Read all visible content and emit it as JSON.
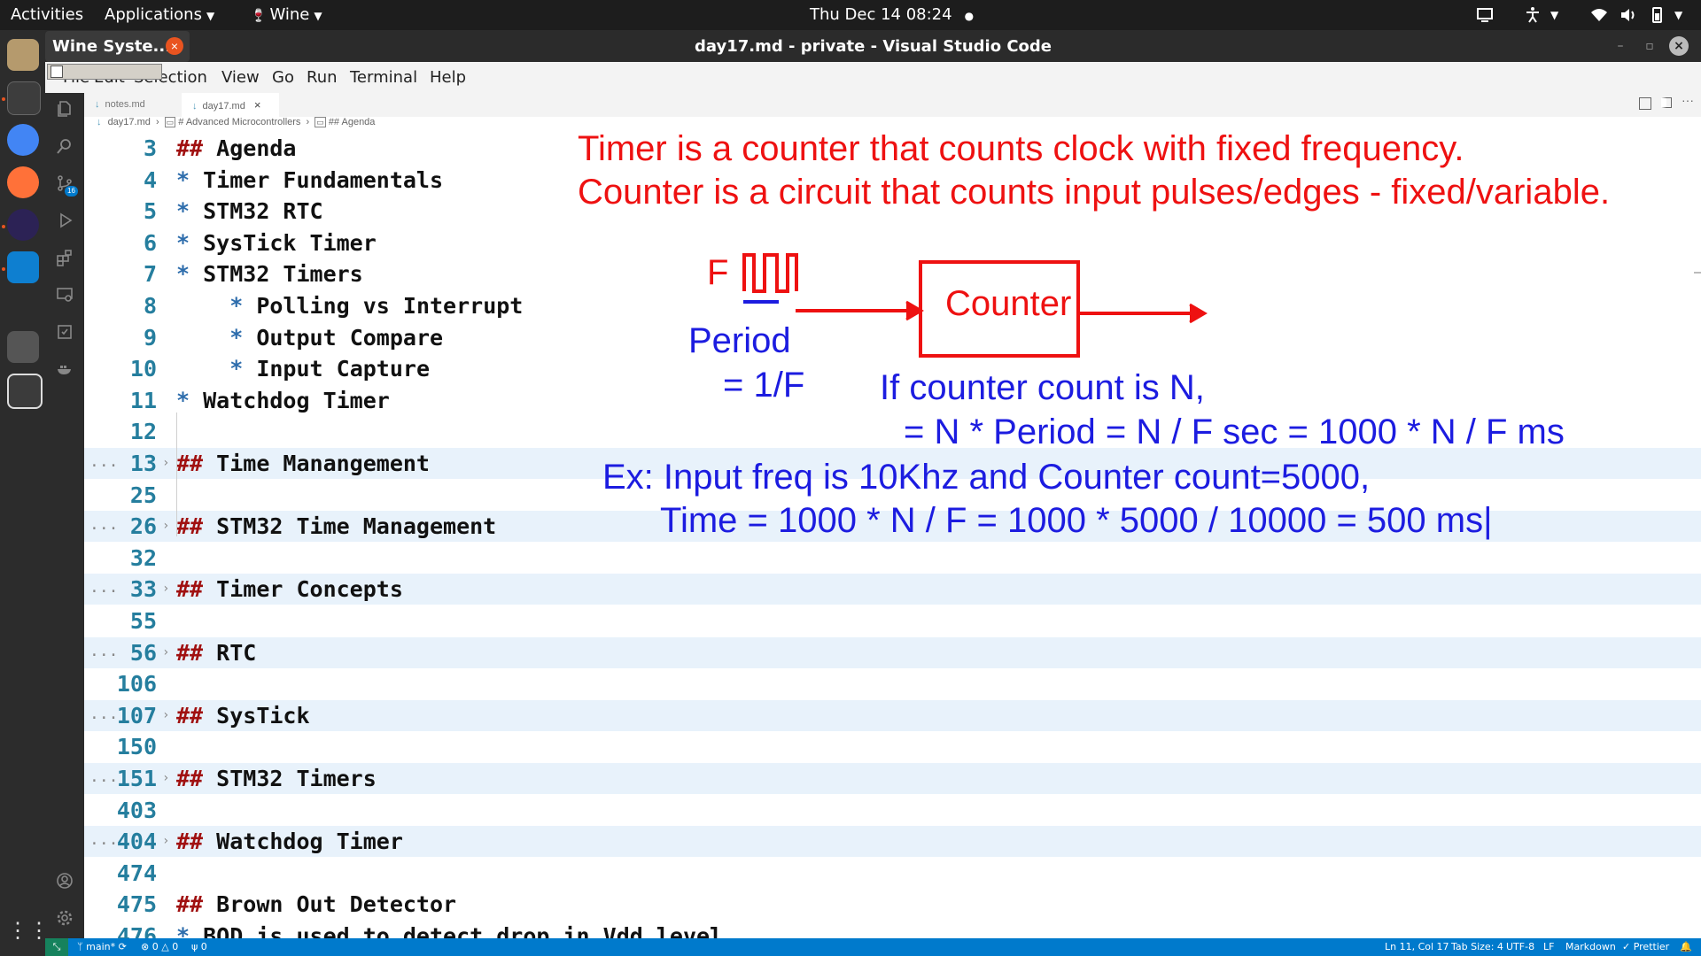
{
  "topbar": {
    "activities": "Activities",
    "applications": "Applications",
    "wine": "Wine",
    "clock": "Thu Dec 14  08:24"
  },
  "wine_window": {
    "title": "Wine Syste...",
    "close": "×"
  },
  "window": {
    "title": "day17.md - private - Visual Studio Code",
    "minimize": "–",
    "maximize": "▫",
    "close": "×"
  },
  "menu": [
    "File",
    "Edit",
    "Selection",
    "View",
    "Go",
    "Run",
    "Terminal",
    "Help"
  ],
  "tabs": [
    {
      "label": "notes.md"
    },
    {
      "label": "day17.md",
      "close": "×"
    }
  ],
  "breadcrumb": {
    "file": "day17.md",
    "h1": "# Advanced Microcontrollers",
    "h2": "## Agenda"
  },
  "source_control_badge": "16",
  "editor_lines": [
    {
      "num": "3",
      "text": "## Agenda"
    },
    {
      "num": "4",
      "text": "* Timer Fundamentals"
    },
    {
      "num": "5",
      "text": "* STM32 RTC"
    },
    {
      "num": "6",
      "text": "* SysTick Timer"
    },
    {
      "num": "7",
      "text": "* STM32 Timers"
    },
    {
      "num": "8",
      "text": "    * Polling vs Interrupt"
    },
    {
      "num": "9",
      "text": "    * Output Compare"
    },
    {
      "num": "10",
      "text": "    * Input Capture"
    },
    {
      "num": "11",
      "text": "* Watchdog Timer"
    },
    {
      "num": "12",
      "text": ""
    },
    {
      "num": "13",
      "text": "## Time Manangement",
      "folded": true
    },
    {
      "num": "25",
      "text": ""
    },
    {
      "num": "26",
      "text": "## STM32 Time Management",
      "folded": true
    },
    {
      "num": "32",
      "text": ""
    },
    {
      "num": "33",
      "text": "## Timer Concepts",
      "folded": true
    },
    {
      "num": "55",
      "text": ""
    },
    {
      "num": "56",
      "text": "## RTC",
      "folded": true
    },
    {
      "num": "106",
      "text": ""
    },
    {
      "num": "107",
      "text": "## SysTick",
      "folded": true
    },
    {
      "num": "150",
      "text": ""
    },
    {
      "num": "151",
      "text": "## STM32 Timers",
      "folded": true
    },
    {
      "num": "403",
      "text": ""
    },
    {
      "num": "404",
      "text": "## Watchdog Timer",
      "folded": true
    },
    {
      "num": "474",
      "text": ""
    },
    {
      "num": "475",
      "text": "## Brown Out Detector"
    },
    {
      "num": "476",
      "text": "* BOD is used to detect drop in Vdd level"
    }
  ],
  "annotations": {
    "line1": "Timer is a counter that counts clock with fixed frequency.",
    "line2": "Counter is a circuit that counts input pulses/edges - fixed/variable.",
    "f_label": "F",
    "counter_box": "Counter",
    "period1": "Period",
    "period2": "= 1/F",
    "count1": "If counter count is N,",
    "count2": "= N * Period = N / F sec = 1000 * N / F ms",
    "ex1": "Ex: Input freq is 10Khz and Counter count=5000,",
    "ex2": "Time = 1000 * N / F = 1000 * 5000 / 10000 = 500 ms|",
    "red_color": "#ee1111",
    "blue_color": "#1c1ce0"
  },
  "statusbar": {
    "branch": "main*",
    "errors": "0",
    "warnings": "0",
    "ports": "0",
    "position": "Ln 11, Col 17",
    "tabsize": "Tab Size: 4",
    "encoding": "UTF-8",
    "eol": "LF",
    "language": "Markdown",
    "prettier": "✓ Prettier"
  }
}
